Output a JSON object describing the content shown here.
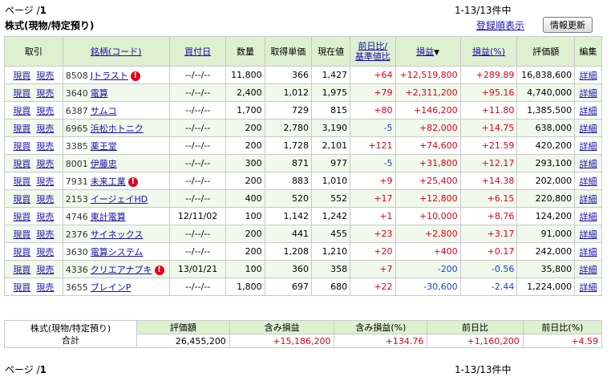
{
  "top": {
    "page_label": "ページ /",
    "page_num": "1",
    "range_text": "1-13/13件中",
    "section_title": "株式(現物/特定預り)",
    "register_order_link": "登録順表示",
    "refresh_button": "情報更新"
  },
  "table": {
    "headers": {
      "trade": "取引",
      "name": "銘柄(コード)",
      "buy_date": "買付日",
      "qty": "数量",
      "unit_cost": "取得単価",
      "price": "現在値",
      "change_l1": "前日比/",
      "change_l2": "基準値比",
      "pl": "損益",
      "pl_sort": "▼",
      "plpct": "損益(%)",
      "value": "評価額",
      "edit": "編集"
    },
    "buy_label": "現買",
    "sell_label": "現売",
    "detail_label": "詳細",
    "rows": [
      {
        "code": "8508",
        "name": "Jトラスト",
        "warn": true,
        "date": "--/--/--",
        "qty": "11,800",
        "cost": "366",
        "price": "1,427",
        "chg": "+64",
        "chg_sign": "pos",
        "pl": "+12,519,800",
        "pl_sign": "pos",
        "plpct": "+289.89",
        "value": "16,838,600"
      },
      {
        "code": "3640",
        "name": "電算",
        "warn": false,
        "date": "--/--/--",
        "qty": "2,400",
        "cost": "1,012",
        "price": "1,975",
        "chg": "+79",
        "chg_sign": "pos",
        "pl": "+2,311,200",
        "pl_sign": "pos",
        "plpct": "+95.16",
        "value": "4,740,000"
      },
      {
        "code": "6387",
        "name": "サムコ",
        "warn": false,
        "date": "--/--/--",
        "qty": "1,700",
        "cost": "729",
        "price": "815",
        "chg": "+80",
        "chg_sign": "pos",
        "pl": "+146,200",
        "pl_sign": "pos",
        "plpct": "+11.80",
        "value": "1,385,500"
      },
      {
        "code": "6965",
        "name": "浜松ホトニク",
        "warn": false,
        "date": "--/--/--",
        "qty": "200",
        "cost": "2,780",
        "price": "3,190",
        "chg": "-5",
        "chg_sign": "neg",
        "pl": "+82,000",
        "pl_sign": "pos",
        "plpct": "+14.75",
        "value": "638,000"
      },
      {
        "code": "3385",
        "name": "薬王堂",
        "warn": false,
        "date": "--/--/--",
        "qty": "200",
        "cost": "1,728",
        "price": "2,101",
        "chg": "+121",
        "chg_sign": "pos",
        "pl": "+74,600",
        "pl_sign": "pos",
        "plpct": "+21.59",
        "value": "420,200"
      },
      {
        "code": "8001",
        "name": "伊藤忠",
        "warn": false,
        "date": "--/--/--",
        "qty": "300",
        "cost": "871",
        "price": "977",
        "chg": "-5",
        "chg_sign": "neg",
        "pl": "+31,800",
        "pl_sign": "pos",
        "plpct": "+12.17",
        "value": "293,100"
      },
      {
        "code": "7931",
        "name": "未来工業",
        "warn": true,
        "date": "--/--/--",
        "qty": "200",
        "cost": "883",
        "price": "1,010",
        "chg": "+9",
        "chg_sign": "pos",
        "pl": "+25,400",
        "pl_sign": "pos",
        "plpct": "+14.38",
        "value": "202,000"
      },
      {
        "code": "2153",
        "name": "イージェイHD",
        "warn": false,
        "date": "--/--/--",
        "qty": "400",
        "cost": "520",
        "price": "552",
        "chg": "+17",
        "chg_sign": "pos",
        "pl": "+12,800",
        "pl_sign": "pos",
        "plpct": "+6.15",
        "value": "220,800"
      },
      {
        "code": "4746",
        "name": "東計電算",
        "warn": false,
        "date": "12/11/02",
        "qty": "100",
        "cost": "1,142",
        "price": "1,242",
        "chg": "+1",
        "chg_sign": "pos",
        "pl": "+10,000",
        "pl_sign": "pos",
        "plpct": "+8.76",
        "value": "124,200"
      },
      {
        "code": "2376",
        "name": "サイネックス",
        "warn": false,
        "date": "--/--/--",
        "qty": "200",
        "cost": "441",
        "price": "455",
        "chg": "+23",
        "chg_sign": "pos",
        "pl": "+2,800",
        "pl_sign": "pos",
        "plpct": "+3.17",
        "value": "91,000"
      },
      {
        "code": "3630",
        "name": "電算システム",
        "warn": false,
        "date": "--/--/--",
        "qty": "200",
        "cost": "1,208",
        "price": "1,210",
        "chg": "+20",
        "chg_sign": "pos",
        "pl": "+400",
        "pl_sign": "pos",
        "plpct": "+0.17",
        "value": "242,000"
      },
      {
        "code": "4336",
        "name": "クリエアナブキ",
        "warn": true,
        "date": "13/01/21",
        "qty": "100",
        "cost": "360",
        "price": "358",
        "chg": "+7",
        "chg_sign": "pos",
        "pl": "-200",
        "pl_sign": "neg",
        "plpct": "-0.56",
        "value": "35,800"
      },
      {
        "code": "3655",
        "name": "ブレインP",
        "warn": false,
        "date": "--/--/--",
        "qty": "1,800",
        "cost": "697",
        "price": "680",
        "chg": "+22",
        "chg_sign": "pos",
        "pl": "-30,600",
        "pl_sign": "neg",
        "plpct": "-2.44",
        "value": "1,224,000"
      }
    ]
  },
  "summary": {
    "label_l1": "株式(現物/特定預り)",
    "label_l2": "合計",
    "h_value": "評価額",
    "h_pl": "含み損益",
    "h_plpct": "含み損益(%)",
    "h_chg": "前日比",
    "h_chgpct": "前日比(%)",
    "value": "26,455,200",
    "pl": "+15,186,200",
    "plpct": "+134.76",
    "chg": "+1,160,200",
    "chgpct": "+4.59"
  },
  "bottom": {
    "page_label": "ページ /",
    "page_num": "1",
    "range_text": "1-13/13件中"
  }
}
